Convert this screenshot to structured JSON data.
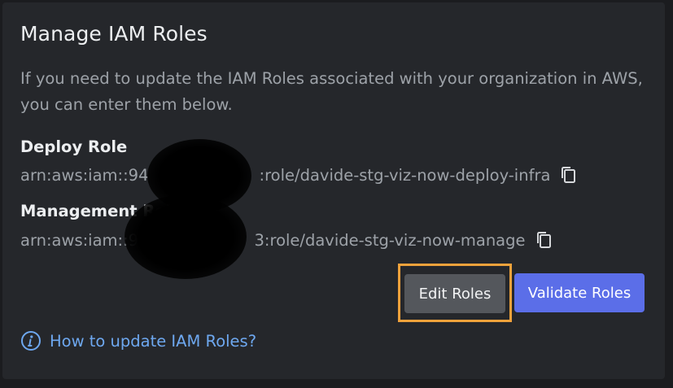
{
  "panel": {
    "title": "Manage IAM Roles",
    "description": "If you need to update the IAM Roles associated with your organization in AWS, you can enter them below."
  },
  "roles": [
    {
      "label": "Deploy Role",
      "arn_prefix": "arn:aws:iam::94",
      "arn_suffix": ":role/davide-stg-viz-now-deploy-infra",
      "icon": "copy-icon"
    },
    {
      "label": "Management Role",
      "arn_prefix": "arn:aws:iam::94",
      "arn_suffix": "3:role/davide-stg-viz-now-manage",
      "icon": "copy-icon"
    }
  ],
  "actions": {
    "edit_label": "Edit Roles",
    "validate_label": "Validate Roles"
  },
  "help": {
    "icon": "info-icon",
    "link_text": "How to update IAM Roles?"
  },
  "colors": {
    "background": "#25272b",
    "primary_button": "#5b6ee8",
    "secondary_button": "#54575c",
    "focus_ring": "#f0a23b",
    "link": "#6ea8f0"
  }
}
